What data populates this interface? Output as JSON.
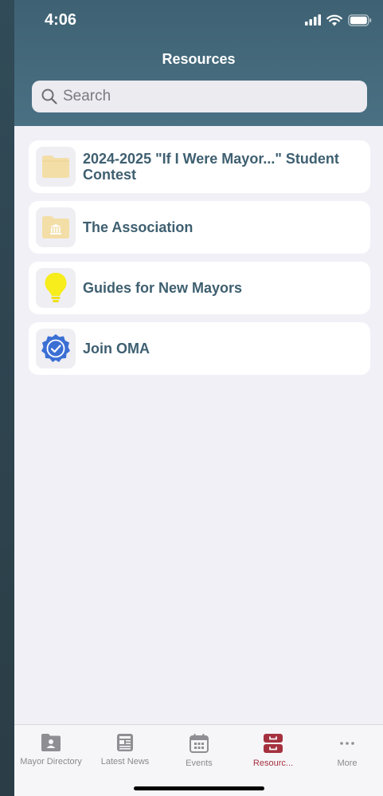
{
  "status_bar": {
    "time": "4:06"
  },
  "header": {
    "title": "Resources"
  },
  "search": {
    "placeholder": "Search"
  },
  "items": [
    {
      "label": "2024-2025 \"If I Were Mayor...\" Student Contest",
      "icon": "folder-icon"
    },
    {
      "label": "The Association",
      "icon": "folder-building-icon"
    },
    {
      "label": "Guides for New Mayors",
      "icon": "lightbulb-icon"
    },
    {
      "label": "Join OMA",
      "icon": "badge-check-icon"
    }
  ],
  "tabs": [
    {
      "label": "Mayor Directory",
      "icon": "contact-folder-icon",
      "active": false
    },
    {
      "label": "Latest News",
      "icon": "newspaper-icon",
      "active": false
    },
    {
      "label": "Events",
      "icon": "calendar-icon",
      "active": false
    },
    {
      "label": "Resourc...",
      "icon": "archive-drawer-icon",
      "active": true
    },
    {
      "label": "More",
      "icon": "more-dots-icon",
      "active": false
    }
  ],
  "colors": {
    "header": "#45697b",
    "accent_active": "#a5313f",
    "item_text": "#3e5f70",
    "background": "#f1f0f7"
  }
}
